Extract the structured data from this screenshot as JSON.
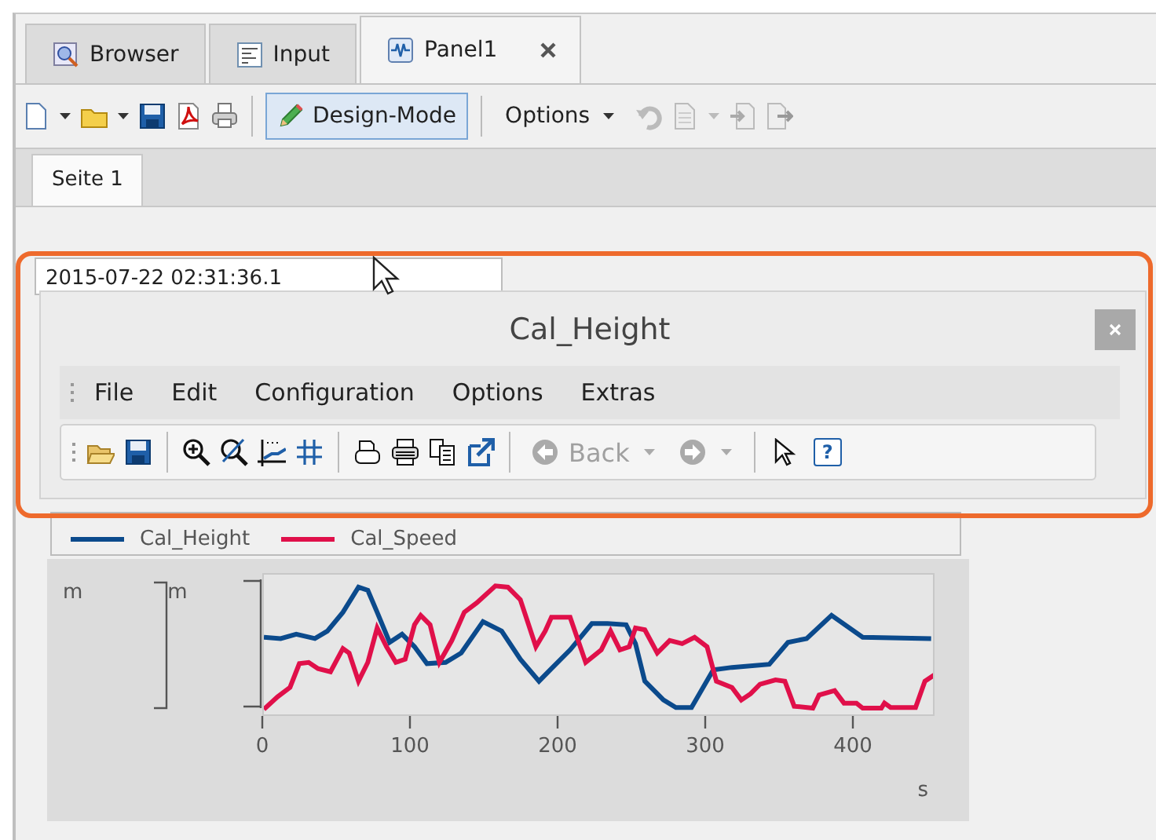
{
  "document_tabs": [
    {
      "label": "Browser",
      "selected": false,
      "closable": false
    },
    {
      "label": "Input",
      "selected": false,
      "closable": false
    },
    {
      "label": "Panel1",
      "selected": true,
      "closable": true
    }
  ],
  "toolbar": {
    "design_mode": {
      "label": "Design-Mode",
      "pressed": true
    },
    "options": {
      "label": "Options"
    }
  },
  "page_tabs": [
    {
      "label": "Seite 1",
      "selected": true
    }
  ],
  "timestamp": "2015-07-22 02:31:36.1",
  "popup": {
    "title": "Cal_Height",
    "menu": [
      "File",
      "Edit",
      "Configuration",
      "Options",
      "Extras"
    ],
    "back": {
      "label": "Back",
      "disabled": true
    },
    "help": "?"
  },
  "legend": [
    {
      "name": "Cal_Height",
      "color": "#0b4a8c"
    },
    {
      "name": "Cal_Speed",
      "color": "#e0104a"
    }
  ],
  "plot": {
    "y_units": [
      "m",
      "m"
    ],
    "x_ticks": [
      "0",
      "100",
      "200",
      "300",
      "400"
    ],
    "x_unit": "s"
  }
}
